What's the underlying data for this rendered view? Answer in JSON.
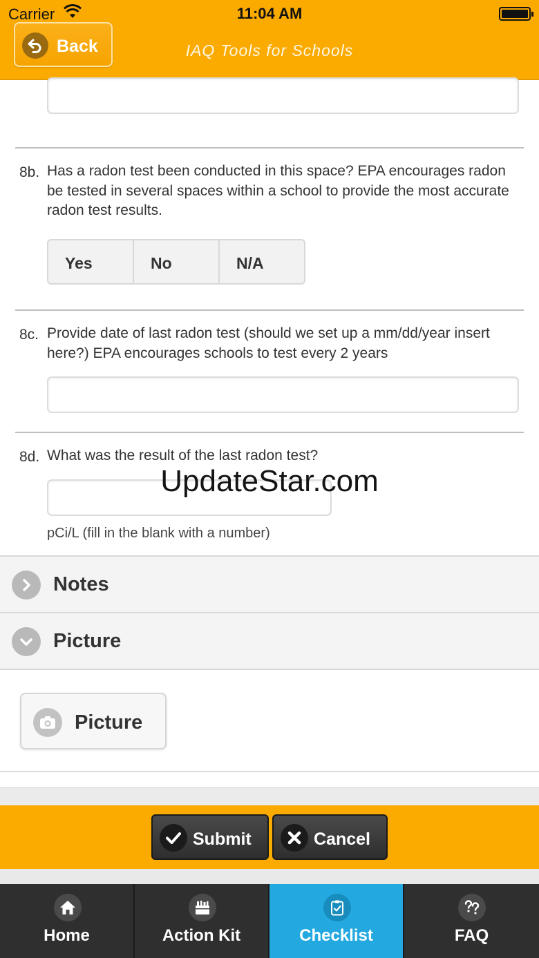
{
  "status_bar": {
    "carrier": "Carrier",
    "time": "11:04 AM"
  },
  "header": {
    "back_label": "Back",
    "title": "IAQ Tools for Schools"
  },
  "questions": [
    {
      "number": "8b.",
      "text": "Has a radon test been conducted in this space? EPA encourages radon be tested in several spaces within a school to provide the most accurate radon test results.",
      "options": [
        "Yes",
        "No",
        "N/A"
      ]
    },
    {
      "number": "8c.",
      "text": "Provide date of last radon test (should we set up a mm/dd/year insert here?) EPA encourages schools to test every 2 years",
      "value": ""
    },
    {
      "number": "8d.",
      "text": "What was the result of the last radon test?",
      "value": "",
      "unit_note": "pCi/L (fill in the blank with a number)"
    }
  ],
  "watermark": "UpdateStar.com",
  "sections": {
    "notes": "Notes",
    "picture": "Picture"
  },
  "picture_button": "Picture",
  "actions": {
    "submit": "Submit",
    "cancel": "Cancel"
  },
  "tabs": [
    {
      "label": "Home",
      "icon": "home-icon"
    },
    {
      "label": "Action Kit",
      "icon": "toolbox-icon"
    },
    {
      "label": "Checklist",
      "icon": "checklist-icon",
      "active": true
    },
    {
      "label": "FAQ",
      "icon": "faq-icon"
    }
  ],
  "colors": {
    "header": "#fbaa00",
    "active_tab": "#23a9e0",
    "tab_bar": "#2f2f2f"
  }
}
